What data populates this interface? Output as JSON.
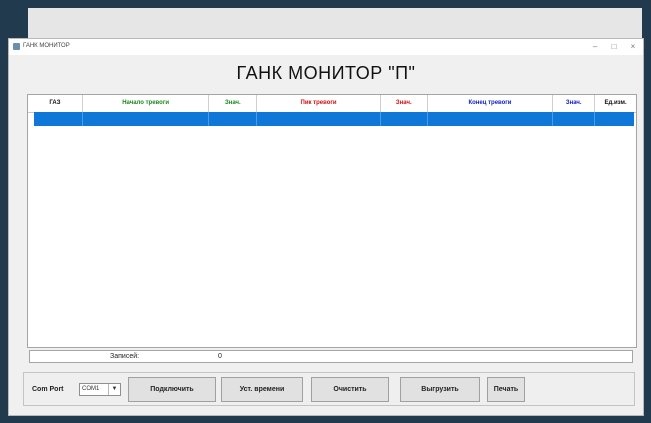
{
  "window": {
    "title": "ГАНК МОНИТОР",
    "controls": {
      "minimize": "–",
      "maximize": "□",
      "close": "×"
    }
  },
  "main_title": "ГАНК МОНИТОР \"П\"",
  "table": {
    "columns": [
      {
        "label": "ГАЗ",
        "color": "#111111"
      },
      {
        "label": "Начало тревоги",
        "color": "#1a8a1a"
      },
      {
        "label": "Знач.",
        "color": "#1a8a1a"
      },
      {
        "label": "Пик тревоги",
        "color": "#d01010"
      },
      {
        "label": "Знач.",
        "color": "#d01010"
      },
      {
        "label": "Конец тревоги",
        "color": "#1020c8"
      },
      {
        "label": "Знач.",
        "color": "#1020c8"
      },
      {
        "label": "Ед.изм.",
        "color": "#111111"
      }
    ],
    "selected_row_color": "#0f77d7"
  },
  "status": {
    "records_label": "Записей:",
    "records_value": "0"
  },
  "toolbar": {
    "com_port_label": "Com Port",
    "com_port_value": "COM1",
    "connect_label": "Подключить",
    "set_time_label": "Уст. времени",
    "clear_label": "Очистить",
    "export_label": "Выгрузить",
    "print_label": "Печать"
  }
}
